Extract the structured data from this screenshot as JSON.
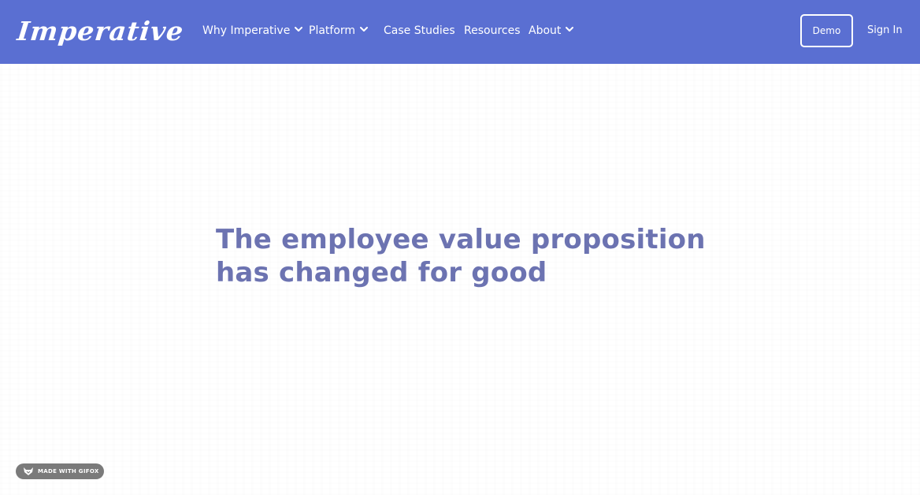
{
  "header": {
    "logo_text": "Imperative",
    "nav": [
      {
        "label": "Why Imperative",
        "has_dropdown": true
      },
      {
        "label": "Platform",
        "has_dropdown": true
      },
      {
        "label": "Case Studies",
        "has_dropdown": false
      },
      {
        "label": "Resources",
        "has_dropdown": false
      },
      {
        "label": "About",
        "has_dropdown": true
      }
    ],
    "demo_label": "Demo",
    "signin_label": "Sign In",
    "bg_color": "#5a6fd2"
  },
  "hero": {
    "headline_line1": "The employee value proposition",
    "headline_line2": "has changed for good",
    "headline_color": "#6c73b1"
  },
  "badge": {
    "label": "MADE WITH GIFOX",
    "icon": "fox-icon"
  }
}
